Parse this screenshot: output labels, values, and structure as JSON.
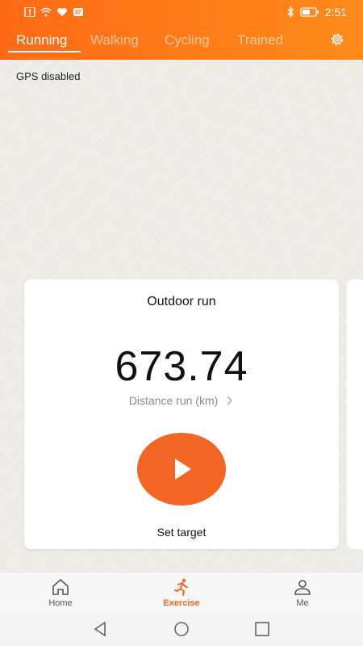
{
  "status": {
    "time": "2:51",
    "icons": [
      "alert-icon",
      "wifi-icon",
      "heart-icon",
      "message-icon",
      "bluetooth-icon",
      "battery-icon"
    ]
  },
  "tabs": [
    {
      "label": "Running",
      "active": true
    },
    {
      "label": "Walking",
      "active": false
    },
    {
      "label": "Cycling",
      "active": false
    },
    {
      "label": "Trained",
      "active": false
    }
  ],
  "gps_status": "GPS disabled",
  "card": {
    "title": "Outdoor run",
    "value": "673.74",
    "label": "Distance run (km)",
    "action": "Set target"
  },
  "bottom_nav": [
    {
      "label": "Home",
      "active": false
    },
    {
      "label": "Exercise",
      "active": true
    },
    {
      "label": "Me",
      "active": false
    }
  ],
  "colors": {
    "accent": "#f26522",
    "header_gradient_start": "#ff6a14",
    "header_gradient_end": "#ff8a1a"
  }
}
